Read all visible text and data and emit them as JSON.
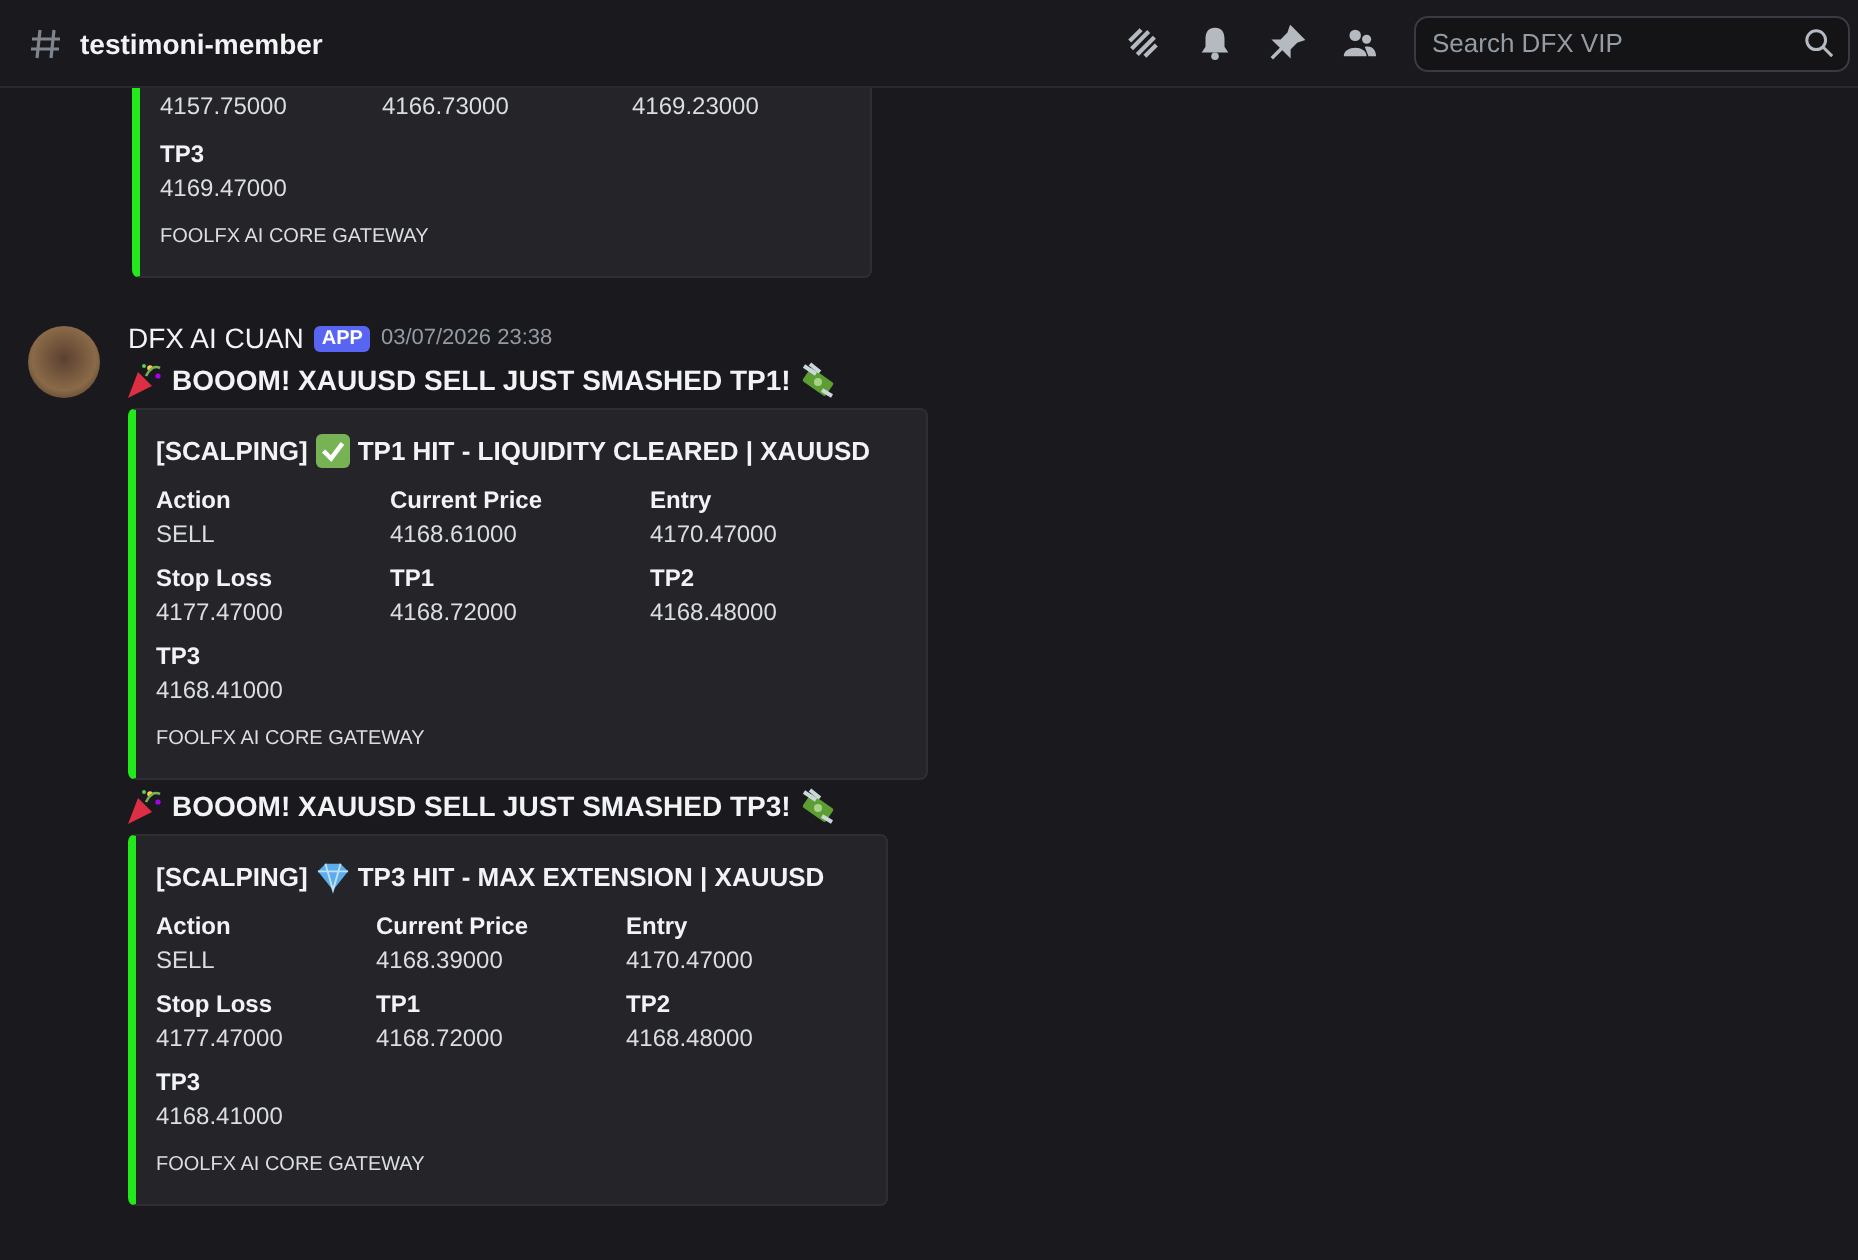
{
  "channel": {
    "name": "testimoni-member"
  },
  "search": {
    "placeholder": "Search DFX VIP"
  },
  "previous_embed": {
    "fields": [
      {
        "value": "4157.75000"
      },
      {
        "value": "4166.73000"
      },
      {
        "value": "4169.23000"
      }
    ],
    "extra_field": {
      "label": "TP3",
      "value": "4169.47000"
    },
    "footer": "FOOLFX AI CORE GATEWAY"
  },
  "message": {
    "author": "DFX AI CUAN",
    "badge": "APP",
    "timestamp": "03/07/2026 23:38",
    "posts": [
      {
        "text": "BOOOM! XAUUSD SELL JUST SMASHED TP1!",
        "embed": {
          "prefix": "[SCALPING]",
          "kind": "check",
          "title": "TP1 HIT - LIQUIDITY CLEARED | XAUUSD",
          "fields": [
            {
              "label": "Action",
              "value": "SELL"
            },
            {
              "label": "Current Price",
              "value": "4168.61000"
            },
            {
              "label": "Entry",
              "value": "4170.47000"
            },
            {
              "label": "Stop Loss",
              "value": "4177.47000"
            },
            {
              "label": "TP1",
              "value": "4168.72000"
            },
            {
              "label": "TP2",
              "value": "4168.48000"
            },
            {
              "label": "TP3",
              "value": "4168.41000"
            }
          ],
          "footer": "FOOLFX AI CORE GATEWAY"
        }
      },
      {
        "text": "BOOOM! XAUUSD SELL JUST SMASHED TP3!",
        "embed": {
          "prefix": "[SCALPING]",
          "kind": "gem",
          "title": "TP3 HIT - MAX EXTENSION | XAUUSD",
          "fields": [
            {
              "label": "Action",
              "value": "SELL"
            },
            {
              "label": "Current Price",
              "value": "4168.39000"
            },
            {
              "label": "Entry",
              "value": "4170.47000"
            },
            {
              "label": "Stop Loss",
              "value": "4177.47000"
            },
            {
              "label": "TP1",
              "value": "4168.72000"
            },
            {
              "label": "TP2",
              "value": "4168.48000"
            },
            {
              "label": "TP3",
              "value": "4168.41000"
            }
          ],
          "footer": "FOOLFX AI CORE GATEWAY"
        }
      }
    ]
  }
}
